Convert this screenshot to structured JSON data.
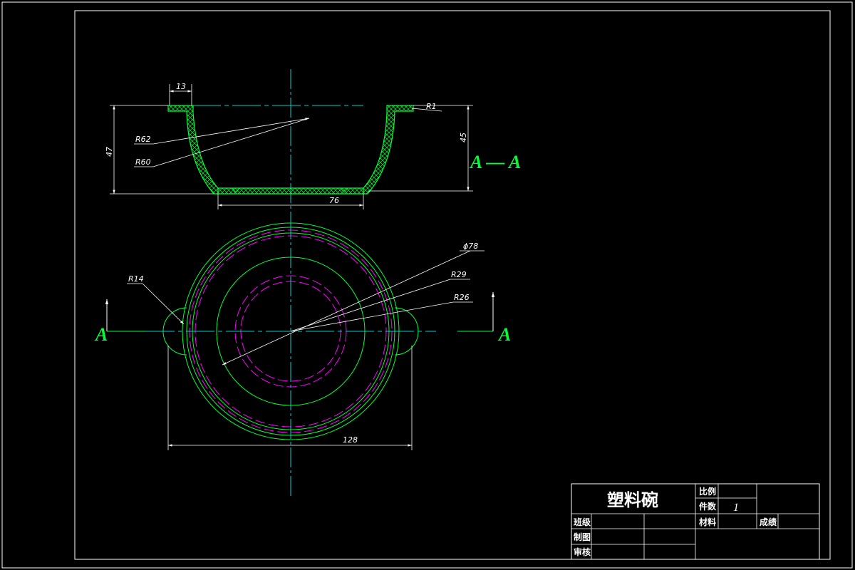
{
  "colors": {
    "background": "#000000",
    "border": "#ffffff",
    "outline": "#00ff33",
    "hidden": "#ff00ff",
    "center": "#00cccc",
    "dimension": "#ffffff",
    "hatch": "#00ff33"
  },
  "dimensions": {
    "rim_width": "13",
    "fillet": "R1",
    "outer_radius": "R62",
    "inner_radius": "R60",
    "total_height": "47",
    "inner_height": "45",
    "base_width": "76",
    "diameter": "ϕ78",
    "radius_29": "R29",
    "radius_26": "R26",
    "handle_radius": "R14",
    "overall_width": "128"
  },
  "section": {
    "title": "A — A",
    "marker_left": "A",
    "marker_right": "A"
  },
  "title_block": {
    "part_name": "塑料碗",
    "scale_label": "比例",
    "count_label": "件数",
    "count_value": "1",
    "class_label": "班级",
    "material_label": "材料",
    "grade_label": "成绩",
    "drawn_label": "制图",
    "review_label": "审核"
  }
}
